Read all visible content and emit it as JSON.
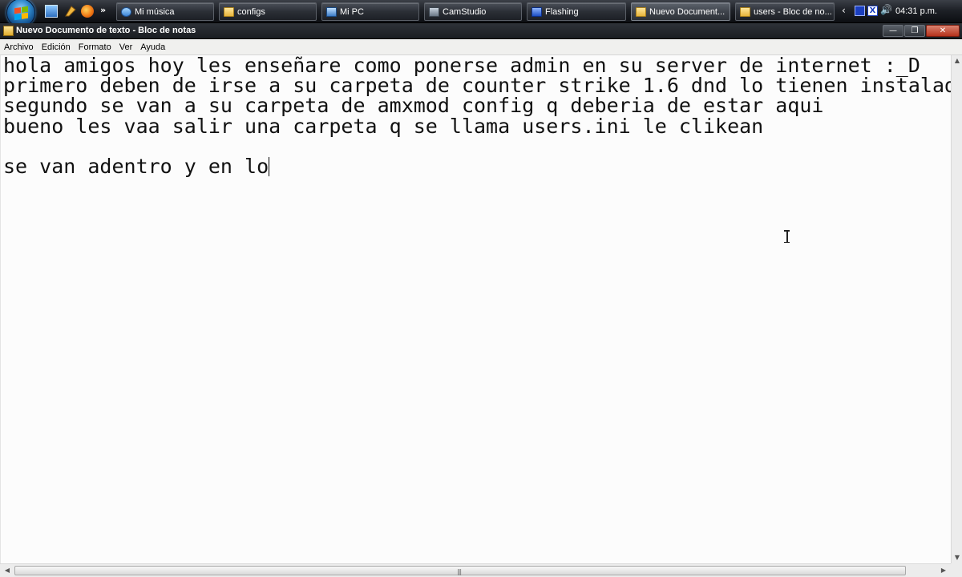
{
  "taskbar": {
    "quick_launch": [
      {
        "icon": "show-desktop-icon"
      },
      {
        "icon": "switch-windows-icon"
      },
      {
        "icon": "firefox-icon"
      }
    ],
    "more_glyph": "»",
    "tasks": [
      {
        "label": "Mi música",
        "icon": "music-icon"
      },
      {
        "label": "configs",
        "icon": "folder-icon"
      },
      {
        "label": "Mi PC",
        "icon": "computer-icon"
      },
      {
        "label": "CamStudio",
        "icon": "camstudio-icon"
      },
      {
        "label": "Flashing",
        "icon": "flash-icon"
      },
      {
        "label": "Nuevo Document...",
        "icon": "notepad-icon"
      },
      {
        "label": "users - Bloc de no...",
        "icon": "notepad-icon"
      }
    ],
    "tray": {
      "chevron": "‹",
      "speaker": "🔊",
      "x_glyph": "X",
      "clock": "04:31 p.m."
    }
  },
  "window": {
    "title": "Nuevo Documento de texto - Bloc de notas",
    "buttons": {
      "minimize": "—",
      "maximize": "❐",
      "close": "✕"
    }
  },
  "menu": {
    "items": [
      "Archivo",
      "Edición",
      "Formato",
      "Ver",
      "Ayuda"
    ]
  },
  "editor": {
    "lines": [
      "hola amigos hoy les enseñare como ponerse admin en su server de internet :_D",
      "primero deben de irse a su carpeta de counter strike 1.6 dnd lo tienen instalad",
      "segundo se van a su carpeta de amxmod config q deberia de estar aqui",
      "bueno les vaa salir una carpeta q se llama users.ini le clikean",
      "",
      "se van adentro y en lo"
    ]
  },
  "scrollbars": {
    "up": "▲",
    "down": "▼",
    "left": "◀",
    "right": "▶",
    "grip": "|||"
  }
}
